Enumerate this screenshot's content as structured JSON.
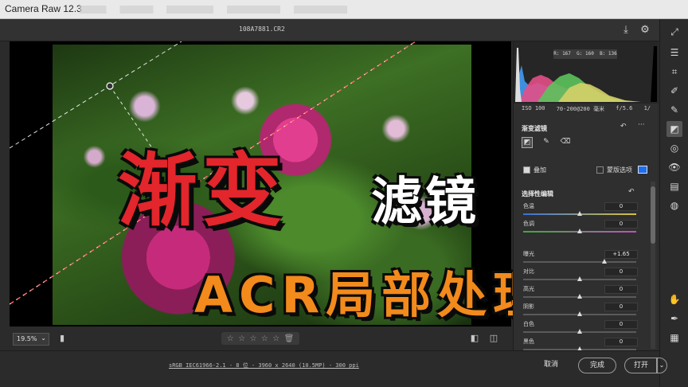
{
  "app": {
    "title": "Camera Raw 12.3"
  },
  "file": {
    "name": "108A7881.CR2"
  },
  "histogram": {
    "r": "R: 167",
    "g": "G: 160",
    "b": "B: 136"
  },
  "camera_info": {
    "iso": "ISO 100",
    "lens": "70-200@200 毫米",
    "aperture": "f/5.6",
    "shutter": "1/"
  },
  "graduated_filter": {
    "title": "渐变滤镜",
    "overlay_label": "叠加",
    "mask_options_label": "蒙版选项",
    "accent_color": "#1d6ff0"
  },
  "selective_edit": {
    "title": "选择性编辑",
    "sliders": [
      {
        "label": "色温",
        "value": "0",
        "pos": 0.5
      },
      {
        "label": "色调",
        "value": "0",
        "pos": 0.5
      },
      {
        "label": "曝光",
        "value": "+1.65",
        "pos": 0.72
      },
      {
        "label": "对比",
        "value": "0",
        "pos": 0.5
      },
      {
        "label": "高光",
        "value": "0",
        "pos": 0.5
      },
      {
        "label": "阴影",
        "value": "0",
        "pos": 0.5
      },
      {
        "label": "白色",
        "value": "0",
        "pos": 0.5
      },
      {
        "label": "黑色",
        "value": "0",
        "pos": 0.5
      }
    ]
  },
  "view": {
    "zoom": "19.5%",
    "rating_stars": 5
  },
  "footer": {
    "meta": "sRGB IEC61966-2.1 - 8 位 - 3960 x 2640 (10.5MP) - 300 ppi",
    "cancel": "取消",
    "done": "完成",
    "open": "打开"
  },
  "overlay_text": {
    "line1": "渐变",
    "line2": "滤镜",
    "line3": "ACR局部处理"
  }
}
